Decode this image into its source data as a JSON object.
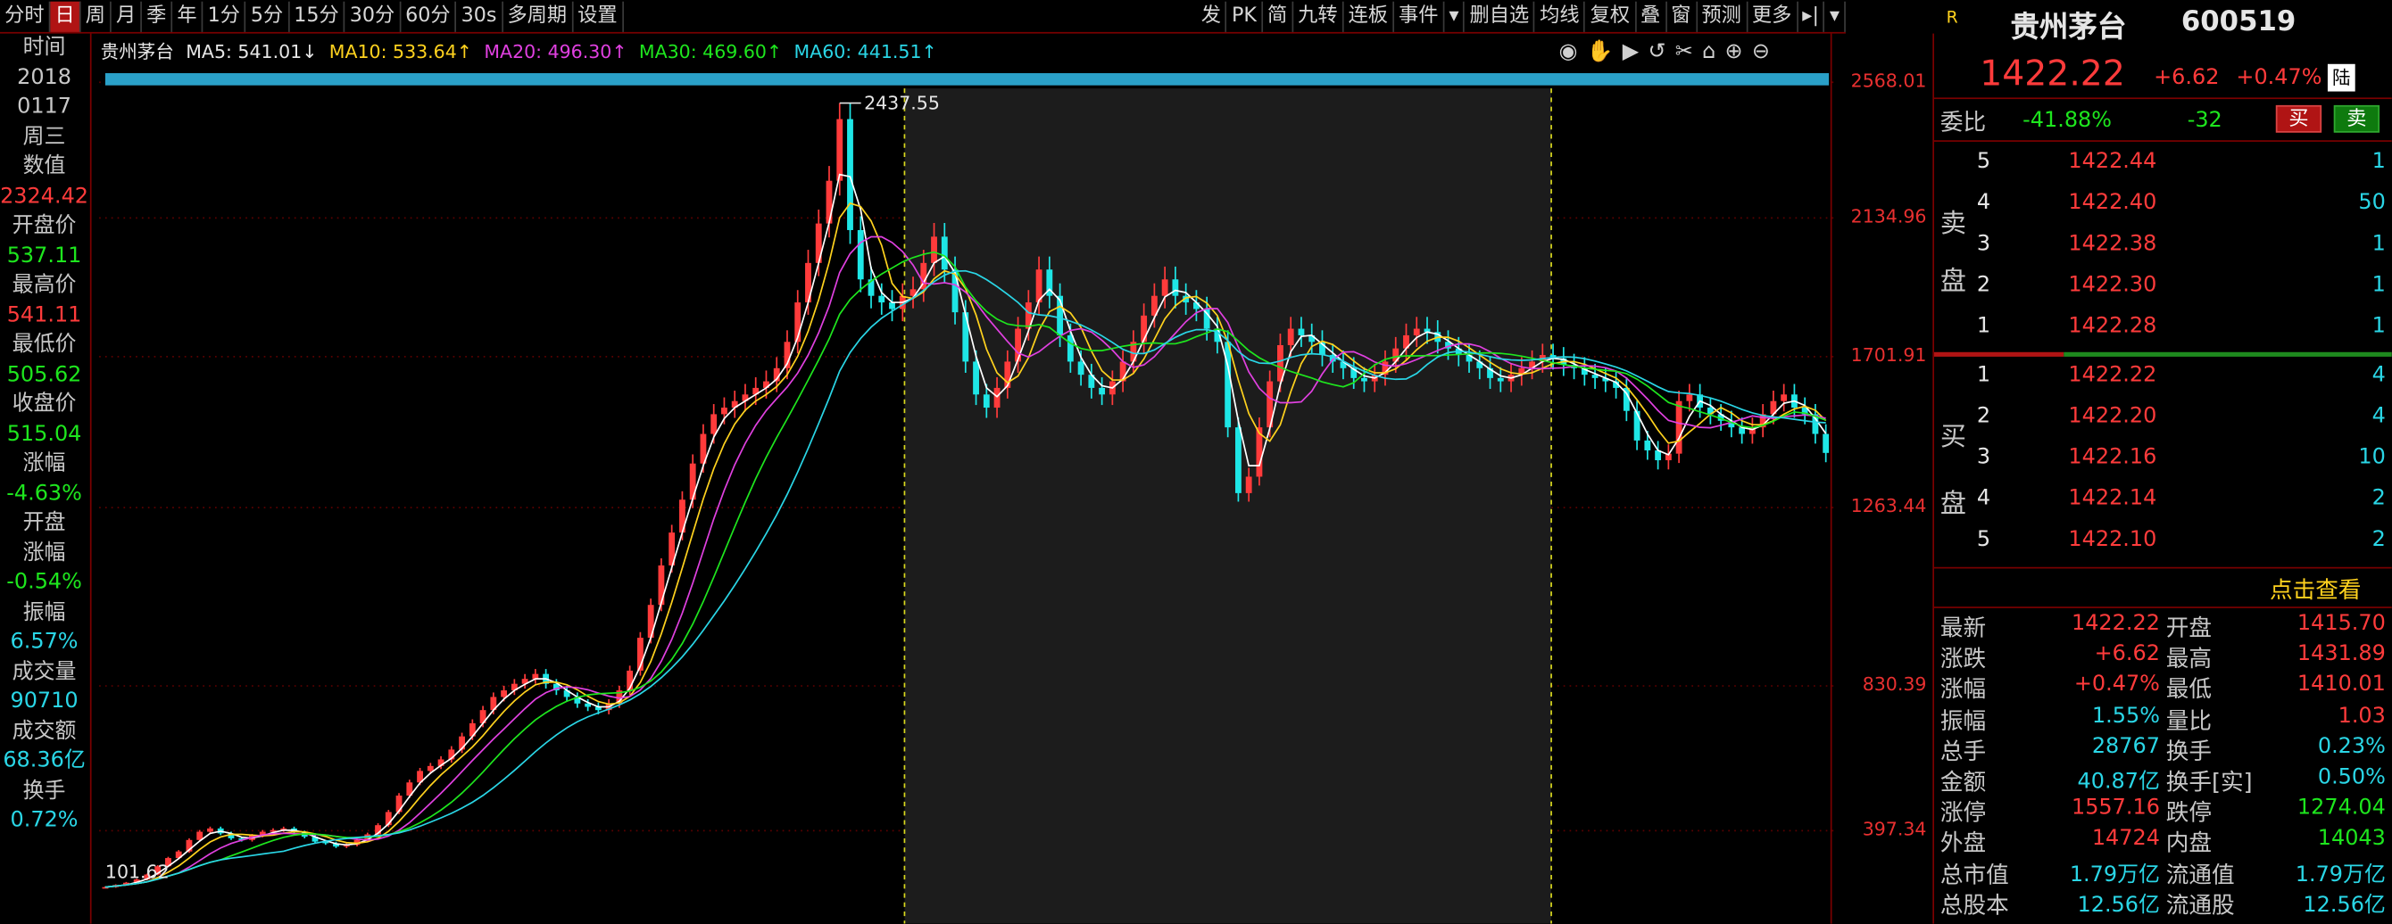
{
  "toolbar": {
    "left": [
      "分时",
      "日",
      "周",
      "月",
      "季",
      "年",
      "1分",
      "5分",
      "15分",
      "30分",
      "60分",
      "30s",
      "多周期",
      "设置"
    ],
    "active_index": 1,
    "right": [
      "发",
      "PK",
      "简",
      "九转",
      "连板",
      "事件",
      "▾",
      "删自选",
      "均线",
      "复权",
      "叠",
      "窗",
      "预测",
      "更多",
      "▸|",
      "▾"
    ]
  },
  "left_info": [
    {
      "text": "时间",
      "cls": "gray"
    },
    {
      "text": "2018",
      "cls": "gray"
    },
    {
      "text": "0117",
      "cls": "gray"
    },
    {
      "text": "周三",
      "cls": "gray"
    },
    {
      "text": "数值",
      "cls": "gray"
    },
    {
      "text": "2324.42",
      "cls": "red"
    },
    {
      "text": "开盘价",
      "cls": "gray"
    },
    {
      "text": "537.11",
      "cls": "green"
    },
    {
      "text": "最高价",
      "cls": "gray"
    },
    {
      "text": "541.11",
      "cls": "red"
    },
    {
      "text": "最低价",
      "cls": "gray"
    },
    {
      "text": "505.62",
      "cls": "green"
    },
    {
      "text": "收盘价",
      "cls": "gray"
    },
    {
      "text": "515.04",
      "cls": "green"
    },
    {
      "text": "涨幅",
      "cls": "gray"
    },
    {
      "text": "-4.63%",
      "cls": "green"
    },
    {
      "text": "开盘",
      "cls": "gray"
    },
    {
      "text": "涨幅",
      "cls": "gray"
    },
    {
      "text": "-0.54%",
      "cls": "green"
    },
    {
      "text": "振幅",
      "cls": "gray"
    },
    {
      "text": "6.57%",
      "cls": "cyan"
    },
    {
      "text": "成交量",
      "cls": "gray"
    },
    {
      "text": "90710",
      "cls": "cyan"
    },
    {
      "text": "成交额",
      "cls": "gray"
    },
    {
      "text": "68.36亿",
      "cls": "cyan"
    },
    {
      "text": "换手",
      "cls": "gray"
    },
    {
      "text": "0.72%",
      "cls": "cyan"
    }
  ],
  "ma": {
    "name": "贵州茅台",
    "ma5": "MA5: 541.01↓",
    "ma10": "MA10: 533.64↑",
    "ma20": "MA20: 496.30↑",
    "ma30": "MA30: 469.60↑",
    "ma60": "MA60: 441.51↑"
  },
  "chart_data": {
    "type": "line",
    "title": "",
    "y_ticks": [
      "2568.01",
      "2134.96",
      "1701.91",
      "1263.44",
      "830.39",
      "397.34"
    ],
    "max_label": "2437.55",
    "min_label": "101.62",
    "y_range": [
      101.62,
      2568.01
    ],
    "close": [
      101.62,
      108,
      115,
      125,
      140,
      165,
      190,
      210,
      245,
      270,
      280,
      265,
      250,
      245,
      258,
      270,
      275,
      280,
      268,
      255,
      240,
      235,
      225,
      230,
      245,
      262,
      290,
      330,
      380,
      420,
      455,
      470,
      490,
      520,
      560,
      600,
      640,
      680,
      700,
      720,
      735,
      750,
      720,
      700,
      680,
      660,
      650,
      640,
      660,
      700,
      760,
      860,
      960,
      1080,
      1180,
      1280,
      1390,
      1480,
      1540,
      1560,
      1580,
      1600,
      1620,
      1640,
      1680,
      1760,
      1880,
      2000,
      2120,
      2250,
      2437.55,
      2100,
      1950,
      1900,
      1880,
      1860,
      1900,
      1920,
      2000,
      2080,
      1980,
      1850,
      1700,
      1600,
      1560,
      1620,
      1700,
      1800,
      1880,
      1980,
      1900,
      1780,
      1700,
      1660,
      1620,
      1600,
      1640,
      1700,
      1760,
      1840,
      1900,
      1950,
      1900,
      1880,
      1860,
      1800,
      1760,
      1500,
      1300,
      1350,
      1500,
      1640,
      1750,
      1800,
      1780,
      1760,
      1720,
      1700,
      1680,
      1650,
      1640,
      1660,
      1700,
      1740,
      1780,
      1800,
      1790,
      1760,
      1740,
      1720,
      1700,
      1680,
      1650,
      1640,
      1660,
      1680,
      1700,
      1720,
      1710,
      1690,
      1680,
      1660,
      1650,
      1640,
      1620,
      1550,
      1460,
      1430,
      1400,
      1420,
      1580,
      1600,
      1560,
      1540,
      1520,
      1500,
      1480,
      1500,
      1540,
      1580,
      1600,
      1560,
      1540,
      1480,
      1422.22
    ]
  },
  "quote": {
    "badge": "R",
    "name": "贵州茅台",
    "code": "600519",
    "price": "1422.22",
    "change": "+6.62",
    "pct": "+0.47%",
    "market": "陆",
    "wb_label": "委比",
    "wb_pct": "-41.88%",
    "wb_diff": "-32",
    "buy_btn": "买",
    "sell_btn": "卖",
    "sell_label": [
      "卖",
      "盘"
    ],
    "buy_label": [
      "买",
      "盘"
    ],
    "sells": [
      {
        "lv": "5",
        "price": "1422.44",
        "vol": "1"
      },
      {
        "lv": "4",
        "price": "1422.40",
        "vol": "50"
      },
      {
        "lv": "3",
        "price": "1422.38",
        "vol": "1"
      },
      {
        "lv": "2",
        "price": "1422.30",
        "vol": "1"
      },
      {
        "lv": "1",
        "price": "1422.28",
        "vol": "1"
      }
    ],
    "buys": [
      {
        "lv": "1",
        "price": "1422.22",
        "vol": "4"
      },
      {
        "lv": "2",
        "price": "1422.20",
        "vol": "4"
      },
      {
        "lv": "3",
        "price": "1422.16",
        "vol": "10"
      },
      {
        "lv": "4",
        "price": "1422.14",
        "vol": "2"
      },
      {
        "lv": "5",
        "price": "1422.10",
        "vol": "2"
      }
    ],
    "click_view": "点击查看",
    "stats": [
      [
        "最新",
        "1422.22",
        "red",
        "开盘",
        "1415.70",
        "red"
      ],
      [
        "涨跌",
        "+6.62",
        "red",
        "最高",
        "1431.89",
        "red"
      ],
      [
        "涨幅",
        "+0.47%",
        "red",
        "最低",
        "1410.01",
        "red"
      ],
      [
        "振幅",
        "1.55%",
        "cyan",
        "量比",
        "1.03",
        "red"
      ],
      [
        "总手",
        "28767",
        "cyan",
        "换手",
        "0.23%",
        "cyan"
      ],
      [
        "金额",
        "40.87亿",
        "cyan",
        "换手[实]",
        "0.50%",
        "cyan"
      ],
      [
        "涨停",
        "1557.16",
        "red",
        "跌停",
        "1274.04",
        "green"
      ],
      [
        "外盘",
        "14724",
        "red",
        "内盘",
        "14043",
        "green"
      ],
      [
        "总市值",
        "1.79万亿",
        "cyan",
        "流通值",
        "1.79万亿",
        "cyan"
      ],
      [
        "总股本",
        "12.56亿",
        "cyan",
        "流通股",
        "12.56亿",
        "cyan"
      ]
    ]
  }
}
